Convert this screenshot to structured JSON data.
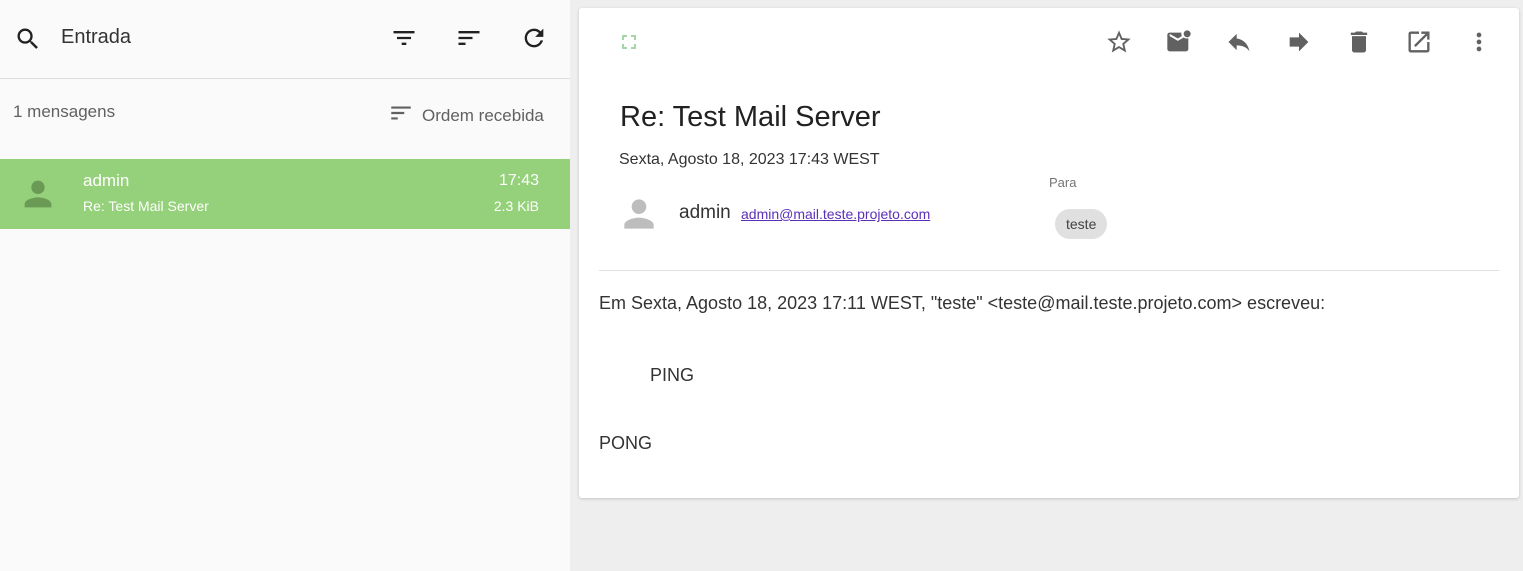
{
  "colors": {
    "accent": "#95d07a",
    "link": "#5c2fb8",
    "background": "#eeeeee",
    "panel": "#fafafa"
  },
  "sidebar": {
    "folder": "Entrada",
    "count": "1 mensagens",
    "order_label": "Ordem recebida",
    "icons": [
      "search-icon",
      "filter-icon",
      "sort-icon",
      "refresh-icon"
    ]
  },
  "messages": [
    {
      "from": "admin",
      "subject": "Re: Test Mail Server",
      "time": "17:43",
      "size": "2.3 KiB"
    }
  ],
  "reader": {
    "subject": "Re: Test Mail Server",
    "date": "Sexta, Agosto 18, 2023 17:43 WEST",
    "sender_name": "admin",
    "sender_email": "admin@mail.teste.projeto.com",
    "to_label": "Para",
    "to_chip": "teste",
    "toolbar_icons": [
      "fullscreen-icon",
      "star-icon",
      "mark-unread-icon",
      "reply-icon",
      "forward-icon",
      "delete-icon",
      "open-external-icon",
      "more-vert-icon"
    ],
    "body": {
      "quote_header": "Em Sexta, Agosto 18, 2023 17:11 WEST, \"teste\" <teste@mail.teste.projeto.com> escreveu:",
      "quoted": "PING",
      "reply": "PONG"
    }
  }
}
